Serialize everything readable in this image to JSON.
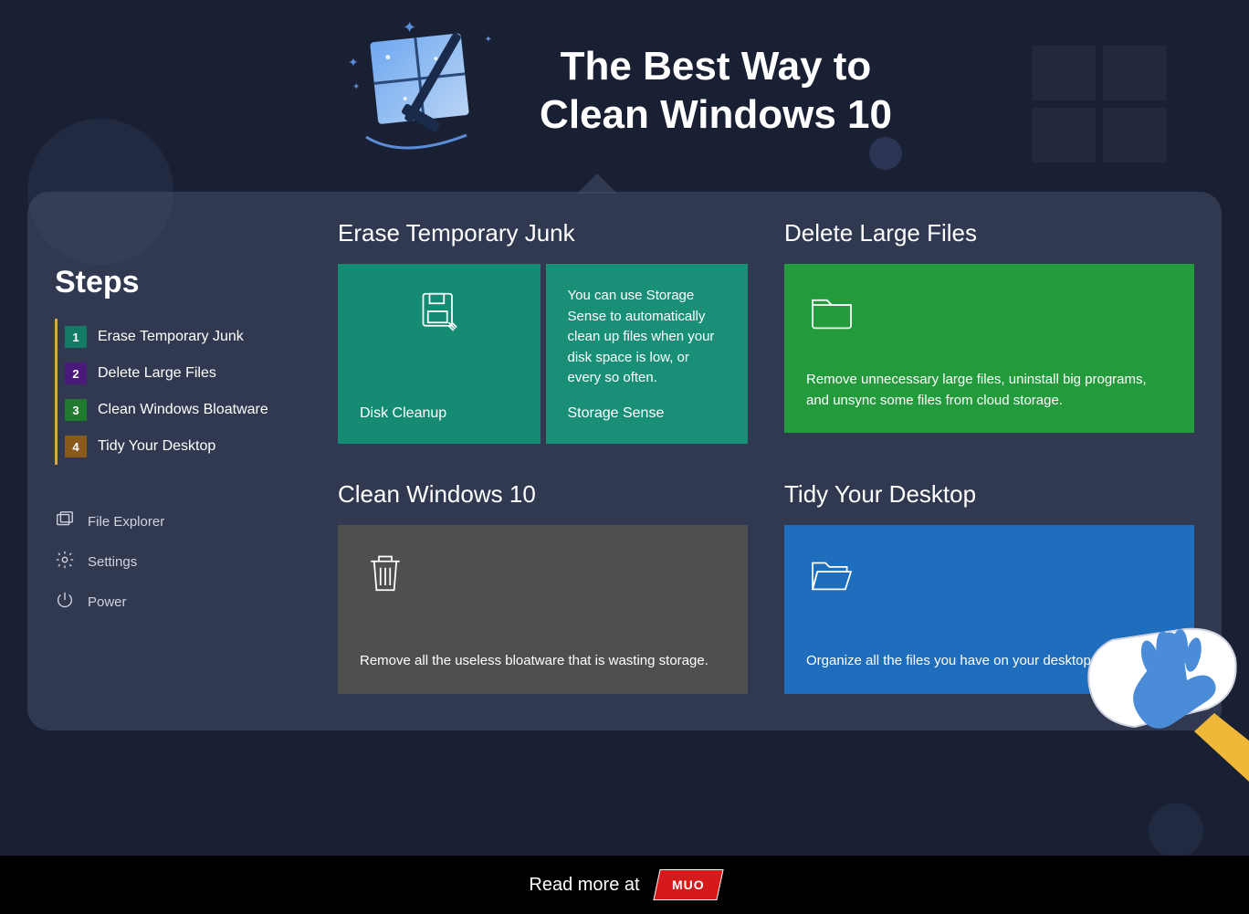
{
  "title": "The Best Way to\nClean Windows 10",
  "sidebar": {
    "heading": "Steps",
    "steps": [
      {
        "num": "1",
        "label": "Erase Temporary Junk"
      },
      {
        "num": "2",
        "label": "Delete Large Files"
      },
      {
        "num": "3",
        "label": "Clean Windows Bloatware"
      },
      {
        "num": "4",
        "label": "Tidy Your Desktop"
      }
    ],
    "links": [
      {
        "label": "File Explorer",
        "icon": "file-explorer-icon"
      },
      {
        "label": "Settings",
        "icon": "gear-icon"
      },
      {
        "label": "Power",
        "icon": "power-icon"
      }
    ]
  },
  "sections": {
    "erase": {
      "title": "Erase Temporary Junk",
      "left_label": "Disk Cleanup",
      "right_text": "You can use Storage Sense to automatically clean up files when your disk space is low, or every so often.",
      "right_label": "Storage Sense"
    },
    "delete": {
      "title": "Delete Large Files",
      "text": "Remove unnecessary large files, uninstall big programs, and unsync some files from cloud storage."
    },
    "clean": {
      "title": "Clean Windows 10",
      "text": "Remove all the useless bloatware that is wasting storage."
    },
    "tidy": {
      "title": "Tidy Your Desktop",
      "text": "Organize all the files you have on your desktop."
    }
  },
  "footer": {
    "text": "Read more at",
    "brand": "MUO"
  }
}
